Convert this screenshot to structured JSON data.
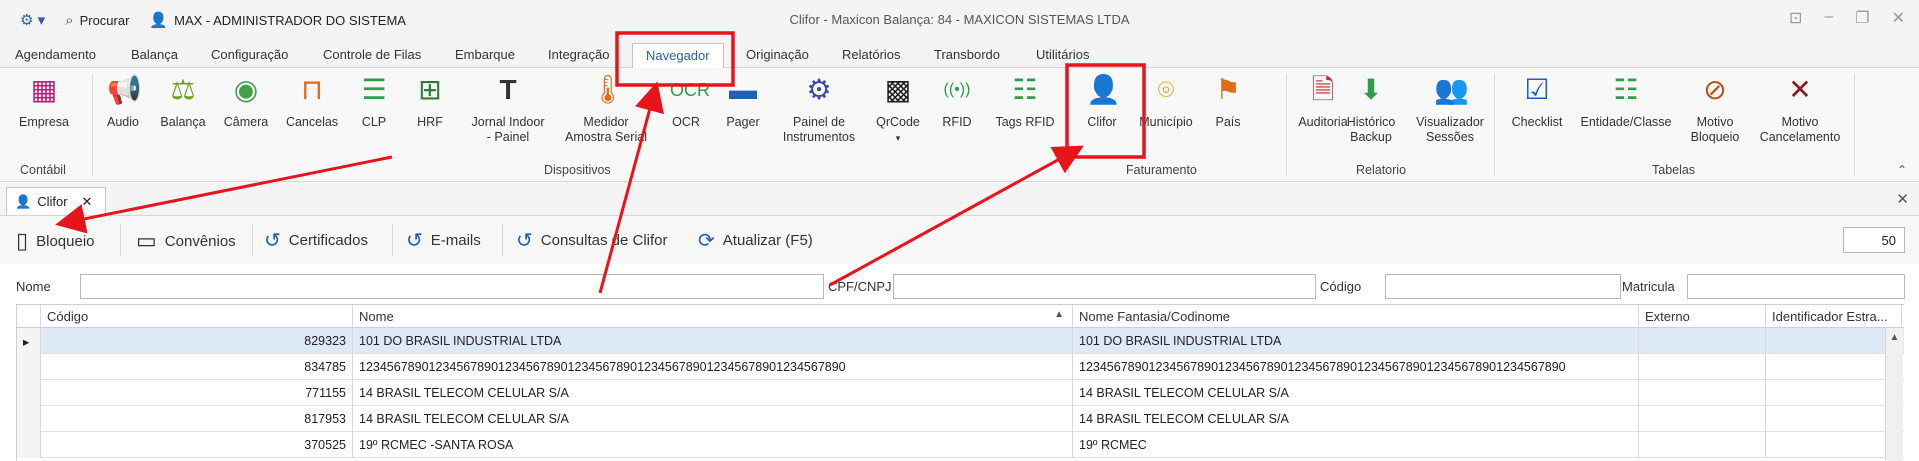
{
  "quick_access": {
    "menu_glyph": "⚙ ▾",
    "search_label": "Procurar",
    "user_label": "MAX - ADMINISTRADOR DO SISTEMA"
  },
  "window": {
    "title": "Clifor - Maxicon Balança: 84 - MAXICON SISTEMAS LTDA",
    "controls": [
      "⊡",
      "–",
      "❐",
      "✕"
    ]
  },
  "menu": [
    "Agendamento",
    "Balança",
    "Configuração",
    "Controle de Filas",
    "Embarque",
    "Integração",
    "Navegador",
    "Originação",
    "Relatórios",
    "Transbordo",
    "Utilitários"
  ],
  "ribbon": {
    "buttons": [
      {
        "label": "Empresa",
        "icon": "building-icon",
        "glyph": "▦",
        "color": "#c2187b"
      },
      {
        "label": "Audio",
        "icon": "megaphone-icon",
        "glyph": "📢",
        "color": "#d21f1f"
      },
      {
        "label": "Balança",
        "icon": "scale-icon",
        "glyph": "⚖",
        "color": "#6aa616"
      },
      {
        "label": "Câmera",
        "icon": "camera-icon",
        "glyph": "◉",
        "color": "#43a047"
      },
      {
        "label": "Cancelas",
        "icon": "barrier-icon",
        "glyph": "⊓",
        "color": "#e06a1a"
      },
      {
        "label": "CLP",
        "icon": "list-icon",
        "glyph": "☰",
        "color": "#2e9e4a"
      },
      {
        "label": "HRF",
        "icon": "network-icon",
        "glyph": "⊞",
        "color": "#2e7d32"
      },
      {
        "label": "Jornal Indoor\n- Painel",
        "icon": "text-panel-icon",
        "glyph": "T",
        "color": "#333333"
      },
      {
        "label": "Medidor\nAmostra Serial",
        "icon": "thermometer-icon",
        "glyph": "🌡",
        "color": "#e06a1a"
      },
      {
        "label": "OCR",
        "icon": "ocr-icon",
        "glyph": "OCR",
        "color": "#2e9e4a"
      },
      {
        "label": "Pager",
        "icon": "pager-icon",
        "glyph": "▬",
        "color": "#1f5fb5"
      },
      {
        "label": "Painel de\nInstrumentos",
        "icon": "gears-icon",
        "glyph": "⚙",
        "color": "#3a46b5"
      },
      {
        "label": "QrCode",
        "icon": "qrcode-icon",
        "glyph": "▩",
        "color": "#222222"
      },
      {
        "label": "RFID",
        "icon": "rfid-icon",
        "glyph": "((•))",
        "color": "#2e9e4a"
      },
      {
        "label": "Tags RFID",
        "icon": "tags-icon",
        "glyph": "☷",
        "color": "#2e9e4a"
      },
      {
        "label": "Clifor",
        "icon": "person-icon",
        "glyph": "👤",
        "color": "#6a3fb5"
      },
      {
        "label": "Município",
        "icon": "map-pin-icon",
        "glyph": "⌾",
        "color": "#e0a21a"
      },
      {
        "label": "País",
        "icon": "map-icon",
        "glyph": "⚑",
        "color": "#e06a1a"
      },
      {
        "label": "Auditoria",
        "icon": "audit-icon",
        "glyph": "🗎",
        "color": "#b52a2a"
      },
      {
        "label": "Histórico\nBackup",
        "icon": "backup-icon",
        "glyph": "⬇",
        "color": "#2e9e4a"
      },
      {
        "label": "Visualizador\nSessões",
        "icon": "users-icon",
        "glyph": "👥",
        "color": "#1f5fb5"
      },
      {
        "label": "Checklist",
        "icon": "checklist-icon",
        "glyph": "☑",
        "color": "#1f5fb5"
      },
      {
        "label": "Entidade/Classe",
        "icon": "entity-icon",
        "glyph": "☷",
        "color": "#2e9e4a"
      },
      {
        "label": "Motivo\nBloqueio",
        "icon": "block-person-icon",
        "glyph": "⊘",
        "color": "#b5531f"
      },
      {
        "label": "Motivo\nCancelamento",
        "icon": "cancel-message-icon",
        "glyph": "✕",
        "color": "#8b1a1a"
      }
    ],
    "groups": [
      "Contábil",
      "Dispositivos",
      "Faturamento",
      "Relatorio",
      "Tabelas"
    ]
  },
  "doc_tab": {
    "label": "Clifor",
    "close": "✕"
  },
  "toolbar": {
    "buttons": [
      {
        "label": "Bloqueio",
        "icon": "block-doc-icon",
        "glyph": "▯"
      },
      {
        "label": "Convênios",
        "icon": "document-icon",
        "glyph": "▭"
      },
      {
        "label": "Certificados",
        "icon": "history-icon",
        "glyph": "↺"
      },
      {
        "label": "E-mails",
        "icon": "history-icon",
        "glyph": "↺"
      },
      {
        "label": "Consultas de Clifor",
        "icon": "history-icon",
        "glyph": "↺"
      },
      {
        "label": "Atualizar (F5)",
        "icon": "refresh-icon",
        "glyph": "⟳"
      }
    ],
    "page_size": "50"
  },
  "filters": {
    "nome": "Nome",
    "cpf": "CPF/CNPJ",
    "codigo": "Código",
    "matricula": "Matricula"
  },
  "grid": {
    "columns": [
      "Código",
      "Nome",
      "Nome Fantasia/Codinome",
      "Externo",
      "Identificador Estra..."
    ],
    "rows": [
      {
        "codigo": "829323",
        "nome": "101 DO BRASIL INDUSTRIAL LTDA",
        "fantasia": "101 DO BRASIL INDUSTRIAL LTDA"
      },
      {
        "codigo": "834785",
        "nome": "1234567890123456789012345678901234567890123456789012345678901234567890",
        "fantasia": "1234567890123456789012345678901234567890123456789012345678901234567890"
      },
      {
        "codigo": "771155",
        "nome": "14 BRASIL TELECOM CELULAR S/A",
        "fantasia": "14 BRASIL TELECOM CELULAR S/A"
      },
      {
        "codigo": "817953",
        "nome": "14 BRASIL TELECOM CELULAR S/A",
        "fantasia": "14 BRASIL TELECOM CELULAR S/A"
      },
      {
        "codigo": "370525",
        "nome": "19º RCMEC -SANTA ROSA",
        "fantasia": "19º RCMEC"
      }
    ]
  },
  "colors": {
    "accent": "#2b5fa8",
    "annotation": "#e8141c",
    "selected_row": "#dde9f6"
  }
}
